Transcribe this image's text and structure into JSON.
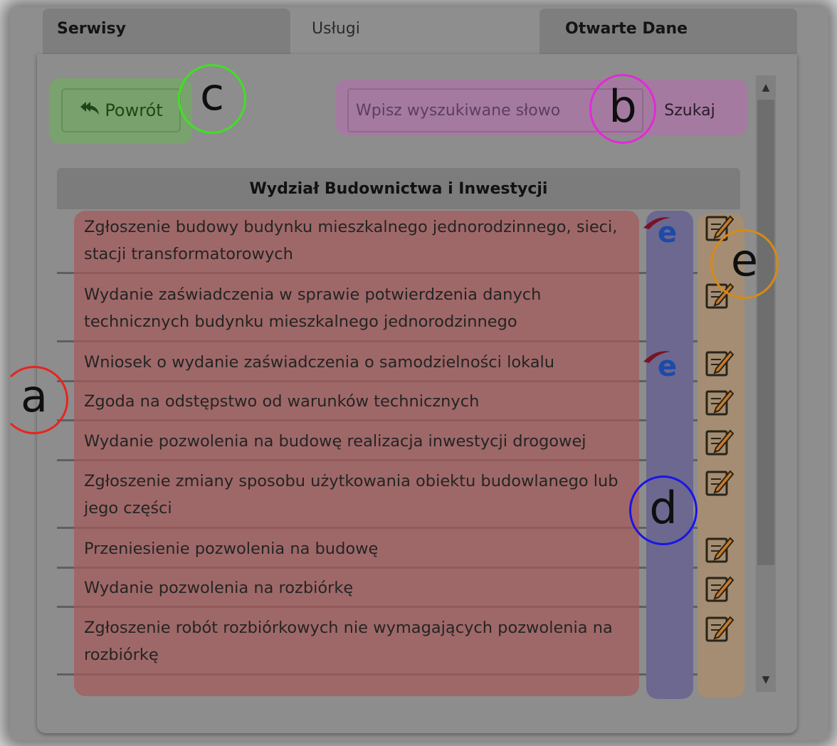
{
  "tabs": [
    {
      "label": "Serwisy"
    },
    {
      "label": "Usługi"
    },
    {
      "label": "Otwarte Dane"
    }
  ],
  "toolbar": {
    "back_label": "Powrót",
    "back_icon": "reply-all-icon"
  },
  "search": {
    "placeholder": "Wpisz wyszukiwane słowo",
    "value": "",
    "button_label": "Szukaj"
  },
  "department": {
    "title": "Wydział Budownictwa i Inwestycji"
  },
  "services": [
    {
      "name": "Zgłoszenie budowy budynku mieszkalnego jednorodzinnego, sieci, stacji transformatorowych",
      "epuap": true,
      "form": true
    },
    {
      "name": "Wydanie zaświadczenia w sprawie potwierdzenia danych technicznych budynku mieszkalnego jednorodzinnego",
      "epuap": false,
      "form": true
    },
    {
      "name": "Wniosek o wydanie zaświadczenia o samodzielności lokalu",
      "epuap": true,
      "form": true
    },
    {
      "name": "Zgoda na odstępstwo od warunków technicznych",
      "epuap": false,
      "form": true
    },
    {
      "name": "Wydanie pozwolenia na budowę realizacja inwestycji drogowej",
      "epuap": false,
      "form": true
    },
    {
      "name": "Zgłoszenie zmiany sposobu użytkowania obiektu budowlanego lub jego części",
      "epuap": false,
      "form": true
    },
    {
      "name": "Przeniesienie pozwolenia na budowę",
      "epuap": false,
      "form": true
    },
    {
      "name": "Wydanie pozwolenia na rozbiórkę",
      "epuap": false,
      "form": true
    },
    {
      "name": "Zgłoszenie robót rozbiórkowych nie wymagających pozwolenia na rozbiórkę",
      "epuap": false,
      "form": true
    }
  ],
  "markers": {
    "a": "a",
    "b": "b",
    "c": "c",
    "d": "d",
    "e": "e"
  },
  "colors": {
    "names_zone": "#a65a5a",
    "search_zone": "#a47aa1",
    "back_zone": "#7aa26e",
    "epuap_zone": "#6c6890",
    "form_zone": "#a48d72",
    "marker_a": "#e8241e",
    "marker_b": "#e22ad6",
    "marker_c": "#40e024",
    "marker_d": "#1a14e6",
    "marker_e": "#d88a14"
  },
  "icons": {
    "epuap": "epuap-e-icon",
    "form": "edit-document-icon",
    "scroll_up": "scroll-up-icon",
    "scroll_down": "scroll-down-icon"
  }
}
